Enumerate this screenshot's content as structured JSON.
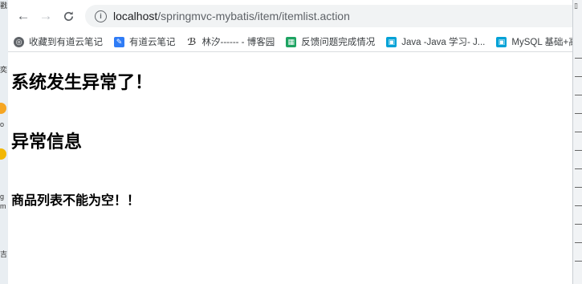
{
  "browser": {
    "url_host": "localhost",
    "url_path": "/springmvc-mybatis/item/itemlist.action",
    "bookmarks": [
      {
        "label": "收藏到有道云笔记",
        "icon": "globe-icon",
        "color": "#5f6368"
      },
      {
        "label": "有道云笔记",
        "icon": "note-icon",
        "color": "#2f7cf6"
      },
      {
        "label": "林汐------ - 博客园",
        "icon": "blog-icon",
        "color": "#444444"
      },
      {
        "label": "反馈问题完成情况",
        "icon": "sheet-icon",
        "color": "#1ea362"
      },
      {
        "label": "Java -Java 学习- J...",
        "icon": "bilibili-icon",
        "color": "#00a1d6"
      },
      {
        "label": "MySQL 基础+高级",
        "icon": "bilibili-icon",
        "color": "#00a1d6"
      }
    ]
  },
  "page": {
    "title": "系统发生异常了！",
    "subtitle": "异常信息",
    "message": "商品列表不能为空！！"
  },
  "desktop": {
    "left_labels": [
      "戳",
      "奕",
      "o",
      "g",
      "m",
      "吉"
    ]
  }
}
